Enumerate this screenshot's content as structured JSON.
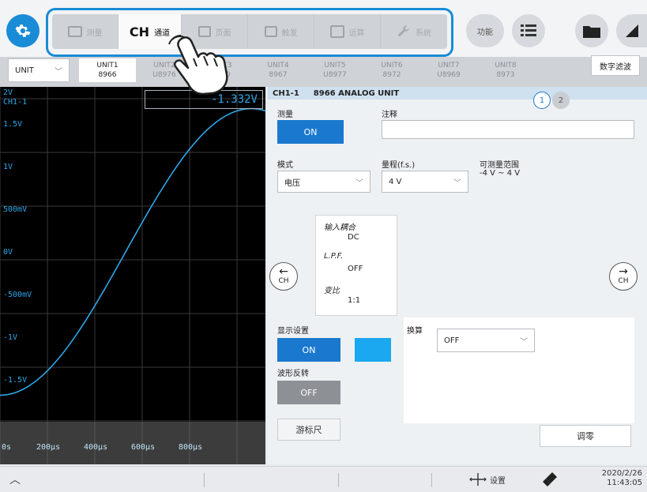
{
  "menu": {
    "tabs": [
      {
        "label": "测量",
        "icon": "waveform-icon"
      },
      {
        "label": "CH",
        "sub": "通道",
        "icon": "channel-icon"
      },
      {
        "label": "页面",
        "icon": "page-icon"
      },
      {
        "label": "触发",
        "icon": "trigger-icon"
      },
      {
        "label": "运算",
        "icon": "calc-icon"
      },
      {
        "label": "系统",
        "icon": "wrench-icon"
      }
    ],
    "func_label": "功能"
  },
  "unitbar": {
    "select_label": "UNIT",
    "units": [
      {
        "name": "UNIT1",
        "model": "8966"
      },
      {
        "name": "UNIT2",
        "model": "U8976"
      },
      {
        "name": "UNIT3",
        "model": "8970"
      },
      {
        "name": "UNIT4",
        "model": "8967"
      },
      {
        "name": "UNIT5",
        "model": "U8977"
      },
      {
        "name": "UNIT6",
        "model": "8972"
      },
      {
        "name": "UNIT7",
        "model": "U8969"
      },
      {
        "name": "UNIT8",
        "model": "8973"
      }
    ],
    "digital_filter": "数字滤波"
  },
  "scope": {
    "range_label": "2V",
    "channel": "CH1-1",
    "readout": "-1.332V",
    "y_labels": [
      "1.5V",
      "1V",
      "500mV",
      "0V",
      "-500mV",
      "-1V",
      "-1.5V"
    ],
    "x_labels": [
      "0s",
      "200μs",
      "400μs",
      "600μs",
      "800μs"
    ],
    "wave_color": "#2ea6e8"
  },
  "panel": {
    "channel": "CH1-1",
    "unit_name": "8966 ANALOG UNIT",
    "pages": [
      "1",
      "2"
    ],
    "measure_label": "测量",
    "measure_value": "ON",
    "comment_label": "注释",
    "comment_value": "",
    "mode_label": "模式",
    "mode_value": "电压",
    "range_label": "量程(f.s.)",
    "range_value": "4 V",
    "measurable_label": "可测量范围",
    "measurable_value": "-4 V ~ 4 V",
    "coupling_label": "输入耦合",
    "coupling_value": "DC",
    "lpf_label": "L.P.F.",
    "lpf_value": "OFF",
    "ratio_label": "变比",
    "ratio_value": "1:1",
    "prev_ch": "CH",
    "next_ch": "CH",
    "display_label": "显示设置",
    "display_value": "ON",
    "display_color": "#1aa8f0",
    "invert_label": "波形反转",
    "invert_value": "OFF",
    "cursor_label": "游标尺",
    "convert_label": "换算",
    "convert_value": "OFF",
    "zero_label": "调零"
  },
  "status": {
    "settings_label": "设置",
    "date": "2020/2/26",
    "time": "11:43:05"
  }
}
